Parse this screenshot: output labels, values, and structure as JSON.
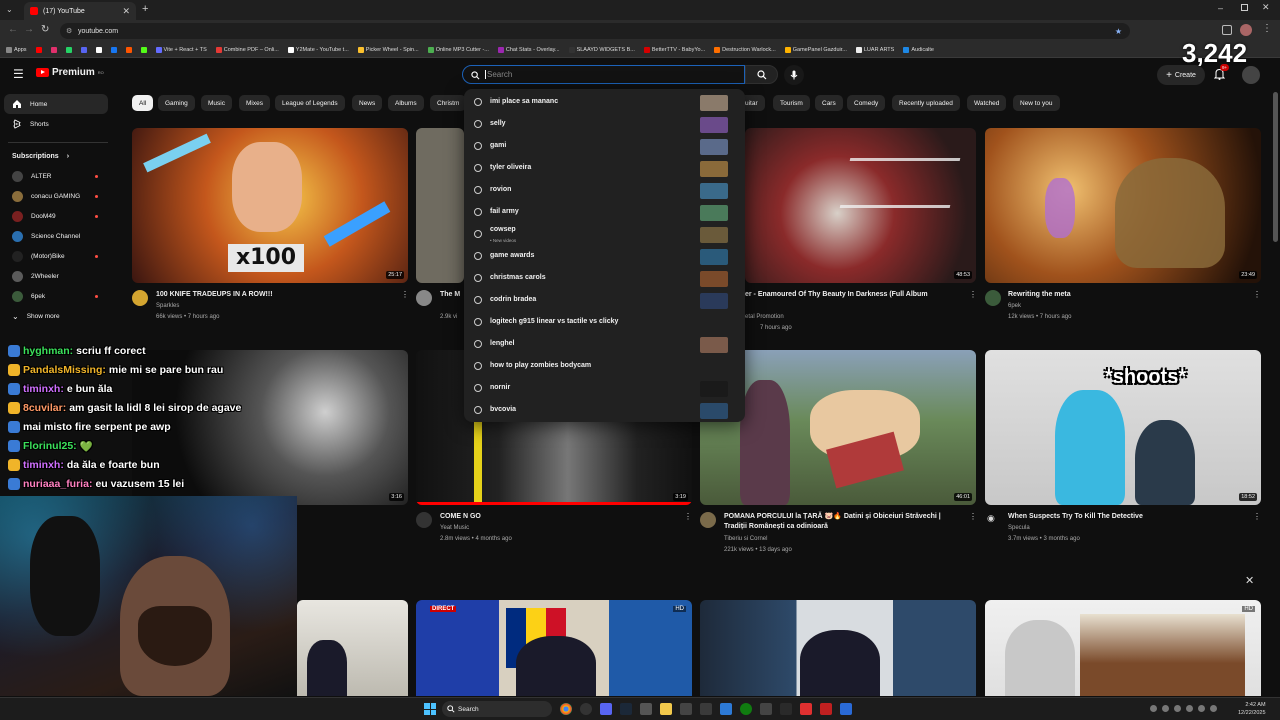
{
  "browser": {
    "tab_title": "(17) YouTube",
    "url": "youtube.com",
    "bookmarks": [
      {
        "label": "Apps",
        "color": "#888888"
      },
      {
        "label": "",
        "color": "#ff0000"
      },
      {
        "label": "",
        "color": "#e1306c"
      },
      {
        "label": "",
        "color": "#25d366"
      },
      {
        "label": "",
        "color": "#5865f2"
      },
      {
        "label": "",
        "color": "#ffffff"
      },
      {
        "label": "",
        "color": "#1877f2"
      },
      {
        "label": "",
        "color": "#ff5500"
      },
      {
        "label": "",
        "color": "#53fc18"
      },
      {
        "label": "Vite + React + TS",
        "color": "#646cff"
      },
      {
        "label": "Combine PDF – Onli...",
        "color": "#e53935"
      },
      {
        "label": "Y2Mate - YouTube t...",
        "color": "#ffffff"
      },
      {
        "label": "Picker Wheel - Spin...",
        "color": "#fbc02d"
      },
      {
        "label": "Online MP3 Cutter -...",
        "color": "#4caf50"
      },
      {
        "label": "Chat Stats - Overlay...",
        "color": "#9c27b0"
      },
      {
        "label": "SLAAYD WIDGETS B...",
        "color": "#333333"
      },
      {
        "label": "BetterTTV - BabyYo...",
        "color": "#d50000"
      },
      {
        "label": "Destruction Warlock...",
        "color": "#ff6f00"
      },
      {
        "label": "GamePanel Gazduir...",
        "color": "#ffb300"
      },
      {
        "label": "LUAR ARTS",
        "color": "#eeeeee"
      },
      {
        "label": "Audicalte",
        "color": "#1e88e5"
      }
    ]
  },
  "header": {
    "logo_text": "Premium",
    "logo_sup": "RO",
    "search_placeholder": "Search",
    "create_label": "Create",
    "notification_count": "9+",
    "viewer_counter": "3,242"
  },
  "sidebar": {
    "items": [
      {
        "label": "Home",
        "icon": "home-icon"
      },
      {
        "label": "Shorts",
        "icon": "shorts-icon"
      }
    ],
    "subscriptions_label": "Subscriptions",
    "subscriptions": [
      {
        "label": "ALTER",
        "color": "#444444",
        "live": true
      },
      {
        "label": "conacu GAMING",
        "color": "#8a6d3b",
        "live": true
      },
      {
        "label": "DooM49",
        "color": "#7a2020",
        "live": true
      },
      {
        "label": "Science Channel",
        "color": "#2a6fb0",
        "live": false
      },
      {
        "label": "(Motor)Bike",
        "color": "#222222",
        "live": true
      },
      {
        "label": "2Wheeler",
        "color": "#5b5b5b",
        "live": false
      },
      {
        "label": "6pek",
        "color": "#3b5b3b",
        "live": true
      }
    ],
    "show_more": "Show more"
  },
  "chips": [
    "All",
    "Gaming",
    "Music",
    "Mixes",
    "League of Legends",
    "News",
    "Albums",
    "Christm",
    "uitar",
    "Tourism",
    "Cars",
    "Comedy",
    "Recently uploaded",
    "Watched",
    "New to you"
  ],
  "search_suggestions": [
    {
      "text": "imi place sa mananc",
      "sub": "",
      "color": "#8a7a6a"
    },
    {
      "text": "selly",
      "sub": "",
      "color": "#6a4a8a"
    },
    {
      "text": "gami",
      "sub": "",
      "color": "#5a6a8a"
    },
    {
      "text": "tyler oliveira",
      "sub": "",
      "color": "#8a6a3a"
    },
    {
      "text": "rovion",
      "sub": "",
      "color": "#3a6a8a"
    },
    {
      "text": "fail army",
      "sub": "",
      "color": "#4a7a5a"
    },
    {
      "text": "cowsep",
      "sub": "• New videos",
      "color": "#6a5a3a"
    },
    {
      "text": "game awards",
      "sub": "",
      "color": "#2a5a7a"
    },
    {
      "text": "christmas carols",
      "sub": "",
      "color": "#7a4a2a"
    },
    {
      "text": "codrin bradea",
      "sub": "",
      "color": "#2a3a5a"
    },
    {
      "text": "logitech g915 linear vs tactile vs clicky",
      "sub": "",
      "color": ""
    },
    {
      "text": "lenghel",
      "sub": "",
      "color": "#7a5a4a"
    },
    {
      "text": "how to play zombies bodycam",
      "sub": "",
      "color": ""
    },
    {
      "text": "nornir",
      "sub": "",
      "color": "#1a1a1a"
    },
    {
      "text": "bvcovia",
      "sub": "",
      "color": "#2a4a6a"
    }
  ],
  "videos": [
    {
      "title": "100 KNIFE TRADEUPS IN A ROW!!!",
      "title2": "",
      "channel": "Sparkles",
      "meta": "66k views • 7 hours ago",
      "duration": "25:17"
    },
    {
      "title": "The M",
      "title2": "",
      "channel": "",
      "meta": "2.9k vi",
      "duration": ""
    },
    {
      "title": "er - Enamoured Of Thy Beauty In Darkness (Full Album",
      "title2": "",
      "channel": "etal Promotion",
      "meta": "7 hours ago",
      "duration": "48:53"
    },
    {
      "title": "Rewriting the meta",
      "title2": "",
      "channel": "6pek",
      "meta": "12k views • 7 hours ago",
      "duration": "23:49"
    },
    {
      "title": "",
      "title2": "",
      "channel": "",
      "meta": "",
      "duration": "3:16"
    },
    {
      "title": "COME N GO",
      "title2": "",
      "channel": "Yeat Music",
      "meta": "2.8m views • 4 months ago",
      "duration": "3:19"
    },
    {
      "title": "POMANA PORCULUI la ȚARĂ 🐷🔥 Datini și Obiceiuri Străvechi |",
      "title2": "Tradiții Românești ca odinioară",
      "channel": "Tiberiu si Cornel",
      "meta": "221k views • 13 days ago",
      "duration": "46:01"
    },
    {
      "title": "When Suspects Try To Kill The Detective",
      "title2": "",
      "channel": "Specula",
      "meta": "3.7m views • 3 months ago",
      "duration": "18:52"
    }
  ],
  "thumb_overlays": {
    "x100": "x100",
    "shoots": "*shoots*",
    "direct": "DIRECT",
    "hd": "HD"
  },
  "chat": [
    {
      "name": "hyghman:",
      "msg": "scriu ff corect",
      "name_color": "#3be15b"
    },
    {
      "name": "PandalsMissing:",
      "msg": "mie mi se pare bun rau",
      "name_color": "#f0b429"
    },
    {
      "name": "timinxh:",
      "msg": "e bun ăla",
      "name_color": "#d070ff"
    },
    {
      "name": "8cuvilar:",
      "msg": "am gasit la lidl 8 lei sirop de agave",
      "name_color": "#ff9966"
    },
    {
      "name": "",
      "msg": "mai misto fire serpent pe awp",
      "name_color": "#3be15b"
    },
    {
      "name": "Florinul25:",
      "msg": "💚",
      "name_color": "#3be15b"
    },
    {
      "name": "timinxh:",
      "msg": "da ăla e foarte bun",
      "name_color": "#d070ff"
    },
    {
      "name": "nuriaaa_furia:",
      "msg": "eu vazusem 15 lei",
      "name_color": "#ff80c0"
    }
  ],
  "taskbar": {
    "search_label": "Search",
    "time": "2:42 AM",
    "date": "12/22/2025"
  }
}
